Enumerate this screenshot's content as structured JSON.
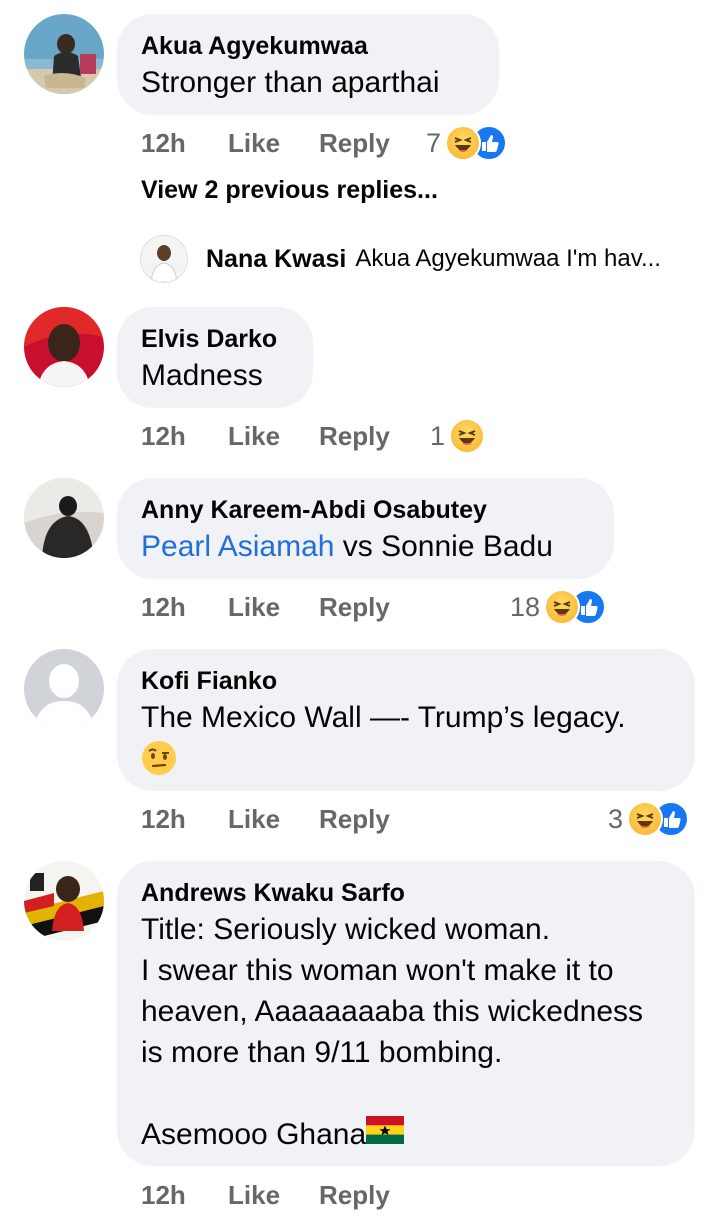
{
  "comments": [
    {
      "author": "Akua Agyekumwaa",
      "text": "Stronger than aparthai",
      "time": "12h",
      "like": "Like",
      "reply": "Reply",
      "reaction_count": "7",
      "reactions": [
        "haha",
        "like"
      ]
    },
    {
      "author": "Elvis Darko",
      "text": "Madness",
      "time": "12h",
      "like": "Like",
      "reply": "Reply",
      "reaction_count": "1",
      "reactions": [
        "haha"
      ]
    },
    {
      "author": "Anny Kareem-Abdi Osabutey",
      "mention": "Pearl Asiamah",
      "text": " vs Sonnie Badu",
      "time": "12h",
      "like": "Like",
      "reply": "Reply",
      "reaction_count": "18",
      "reactions": [
        "haha",
        "like"
      ]
    },
    {
      "author": "Kofi Fianko",
      "text": "The Mexico Wall —- Trump’s legacy.",
      "emoji": "face-with-raised-eyebrow",
      "time": "12h",
      "like": "Like",
      "reply": "Reply",
      "reaction_count": "3",
      "reactions": [
        "haha",
        "like"
      ]
    },
    {
      "author": "Andrews Kwaku Sarfo",
      "lines": [
        "Title: Seriously wicked woman.",
        "I swear this woman won't make it to",
        "heaven, Aaaaaaaaba this wickedness",
        "is more than 9/11 bombing.",
        "",
        "Asemooo Ghana"
      ],
      "flag": "ghana-flag",
      "time": "12h",
      "like": "Like",
      "reply": "Reply"
    }
  ],
  "view_previous": "View 2 previous replies...",
  "reply_preview": {
    "name": "Nana Kwasi",
    "text": "Akua Agyekumwaa I'm hav..."
  },
  "colors": {
    "bubble": "#f0f2f5",
    "link": "#216fdb",
    "meta": "#65676b",
    "like_blue": "#1877f2",
    "haha_yellow": "#f7b125"
  }
}
